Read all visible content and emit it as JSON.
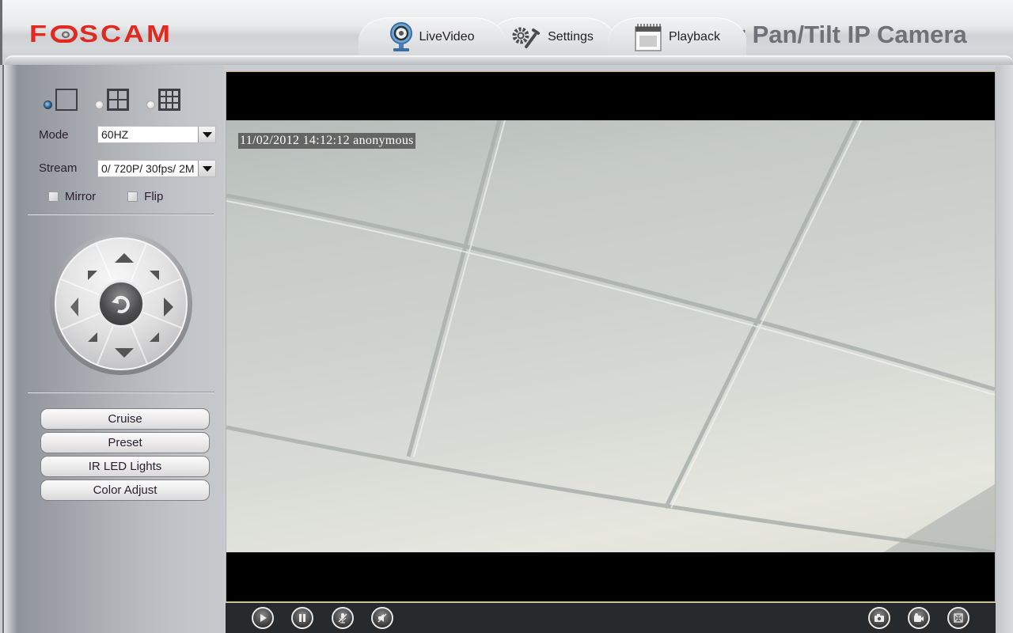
{
  "header": {
    "brand": "FOSCAM",
    "product_title": "or Pan/Tilt IP Camera",
    "tabs": [
      {
        "label": "LiveVideo",
        "icon": "webcam-icon",
        "active": true
      },
      {
        "label": "Settings",
        "icon": "gear-wrench-icon",
        "active": false
      },
      {
        "label": "Playback",
        "icon": "calendar-icon",
        "active": false
      }
    ]
  },
  "sidebar": {
    "layouts": [
      {
        "name": "single-view",
        "selected": true
      },
      {
        "name": "quad-view",
        "selected": false
      },
      {
        "name": "nine-view",
        "selected": false
      }
    ],
    "mode": {
      "label": "Mode",
      "value": "60HZ"
    },
    "stream": {
      "label": "Stream",
      "value": "0/ 720P/ 30fps/ 2M"
    },
    "mirror": {
      "label": "Mirror",
      "checked": false
    },
    "flip": {
      "label": "Flip",
      "checked": false
    },
    "ptz": {
      "buttons": [
        "up",
        "down",
        "left",
        "right",
        "up-left",
        "up-right",
        "down-left",
        "down-right",
        "center-reset"
      ]
    },
    "buttons": [
      {
        "label": "Cruise"
      },
      {
        "label": "Preset"
      },
      {
        "label": "IR LED Lights"
      },
      {
        "label": "Color Adjust"
      }
    ]
  },
  "video": {
    "osd_text": "11/02/2012 14:12:12 anonymous",
    "controls_left": [
      "play-icon",
      "pause-icon",
      "microphone-off-icon",
      "speaker-off-icon"
    ],
    "controls_right": [
      "snapshot-icon",
      "record-icon",
      "fullscreen-icon"
    ]
  }
}
